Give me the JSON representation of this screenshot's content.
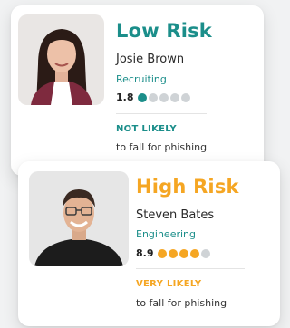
{
  "colors": {
    "low": "#1b8e8a",
    "high": "#f5a623",
    "dot_empty": "#cfd3d6"
  },
  "cards": [
    {
      "risk_label": "Low Risk",
      "name": "Josie Brown",
      "department": "Recruiting",
      "score": "1.8",
      "filled_dots": 1,
      "total_dots": 5,
      "likelihood": "NOT LIKELY",
      "phish_text": "to fall for phishing",
      "accent": "#1b8e8a"
    },
    {
      "risk_label": "High Risk",
      "name": "Steven Bates",
      "department": "Engineering",
      "score": "8.9",
      "filled_dots": 4,
      "total_dots": 5,
      "likelihood": "VERY LIKELY",
      "phish_text": "to fall for phishing",
      "accent": "#f5a623"
    }
  ]
}
